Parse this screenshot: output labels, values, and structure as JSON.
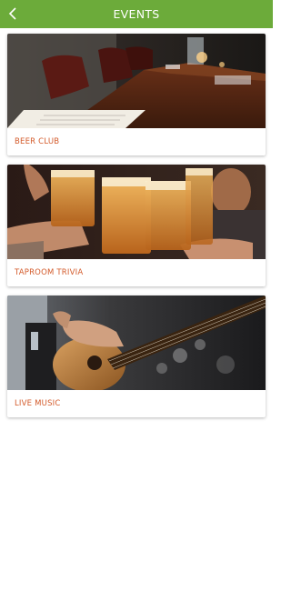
{
  "header": {
    "title": "EVENTS",
    "back_icon": "chevron-left-icon",
    "background": "#6cab3a"
  },
  "events": [
    {
      "label": "BEER CLUB",
      "image": "restaurant-table-photo"
    },
    {
      "label": "TAPROOM TRIVIA",
      "image": "beer-toast-photo"
    },
    {
      "label": "LIVE MUSIC",
      "image": "guitar-player-photo"
    }
  ],
  "colors": {
    "label_accent": "#d35a2a"
  }
}
